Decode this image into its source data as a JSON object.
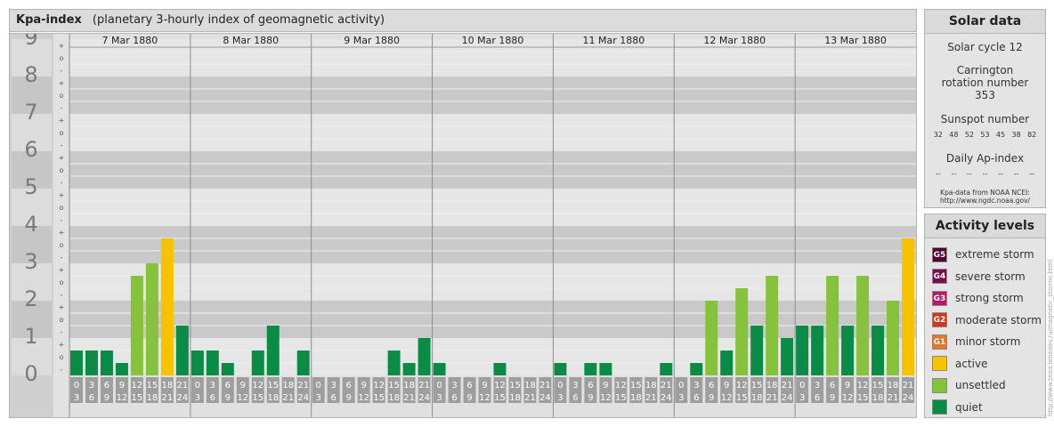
{
  "header": {
    "title": "Kpa-index",
    "subtitle": "(planetary 3-hourly index of geomagnetic activity)"
  },
  "chart_data": {
    "type": "bar",
    "title": "Kpa-index",
    "subtitle": "(planetary 3-hourly index of geomagnetic activity)",
    "ylim": [
      0,
      9
    ],
    "y_ticks": [
      "0",
      "1",
      "2",
      "3",
      "4",
      "5",
      "6",
      "7",
      "8",
      "9"
    ],
    "sub_ticks": [
      "-",
      "o",
      "+"
    ],
    "days": [
      "7 Mar 1880",
      "8 Mar 1880",
      "9 Mar 1880",
      "10 Mar 1880",
      "11 Mar 1880",
      "12 Mar 1880",
      "13 Mar 1880"
    ],
    "interval_starts": [
      "0",
      "3",
      "6",
      "9",
      "12",
      "15",
      "18",
      "21"
    ],
    "interval_ends": [
      "3",
      "6",
      "9",
      "12",
      "15",
      "18",
      "21",
      "24"
    ],
    "values": [
      [
        0.667,
        0.667,
        0.667,
        0.333,
        2.667,
        3.0,
        3.667,
        1.333
      ],
      [
        0.667,
        0.667,
        0.333,
        0.0,
        0.667,
        1.333,
        0.0,
        0.667
      ],
      [
        0.0,
        0.0,
        0.0,
        0.0,
        0.0,
        0.667,
        0.333,
        1.0
      ],
      [
        0.333,
        0.0,
        0.0,
        0.0,
        0.333,
        0.0,
        0.0,
        0.0
      ],
      [
        0.333,
        0.0,
        0.333,
        0.333,
        0.0,
        0.0,
        0.0,
        0.333
      ],
      [
        0.0,
        0.333,
        2.0,
        0.667,
        2.333,
        1.333,
        2.667,
        1.0
      ],
      [
        1.333,
        1.333,
        2.667,
        1.333,
        2.667,
        1.333,
        2.0,
        3.667
      ]
    ],
    "colors": {
      "quiet": "#0a8c46",
      "unsettled": "#86c23c",
      "active": "#f7c300"
    }
  },
  "solar": {
    "title": "Solar data",
    "cycle": "Solar cycle 12",
    "carrington": "Carrington rotation number 353",
    "sunspot_label": "Sunspot number",
    "sunspots": [
      "32",
      "48",
      "52",
      "53",
      "45",
      "38",
      "82"
    ],
    "ap_label": "Daily Ap-index",
    "ap_values": [
      "--",
      "--",
      "--",
      "--",
      "--",
      "--",
      "--"
    ],
    "source_line1": "Kpa-data from NOAA NCEI:",
    "source_line2": "http://www.ngdc.noaa.gov/"
  },
  "activity": {
    "title": "Activity levels",
    "levels": [
      {
        "badge": "G5",
        "label": "extreme storm",
        "color": "#52002e"
      },
      {
        "badge": "G4",
        "label": "severe storm",
        "color": "#7a0c4e"
      },
      {
        "badge": "G3",
        "label": "strong storm",
        "color": "#b51a6a"
      },
      {
        "badge": "G2",
        "label": "moderate storm",
        "color": "#d2371e"
      },
      {
        "badge": "G1",
        "label": "minor storm",
        "color": "#e0782a"
      },
      {
        "badge": "",
        "label": "active",
        "color": "#f7c300"
      },
      {
        "badge": "",
        "label": "unsettled",
        "color": "#86c23c"
      },
      {
        "badge": "",
        "label": "quiet",
        "color": "#0a8c46"
      }
    ]
  },
  "watermark": "http://www.tesis.lebedev.ru/magnetic_storms.html"
}
